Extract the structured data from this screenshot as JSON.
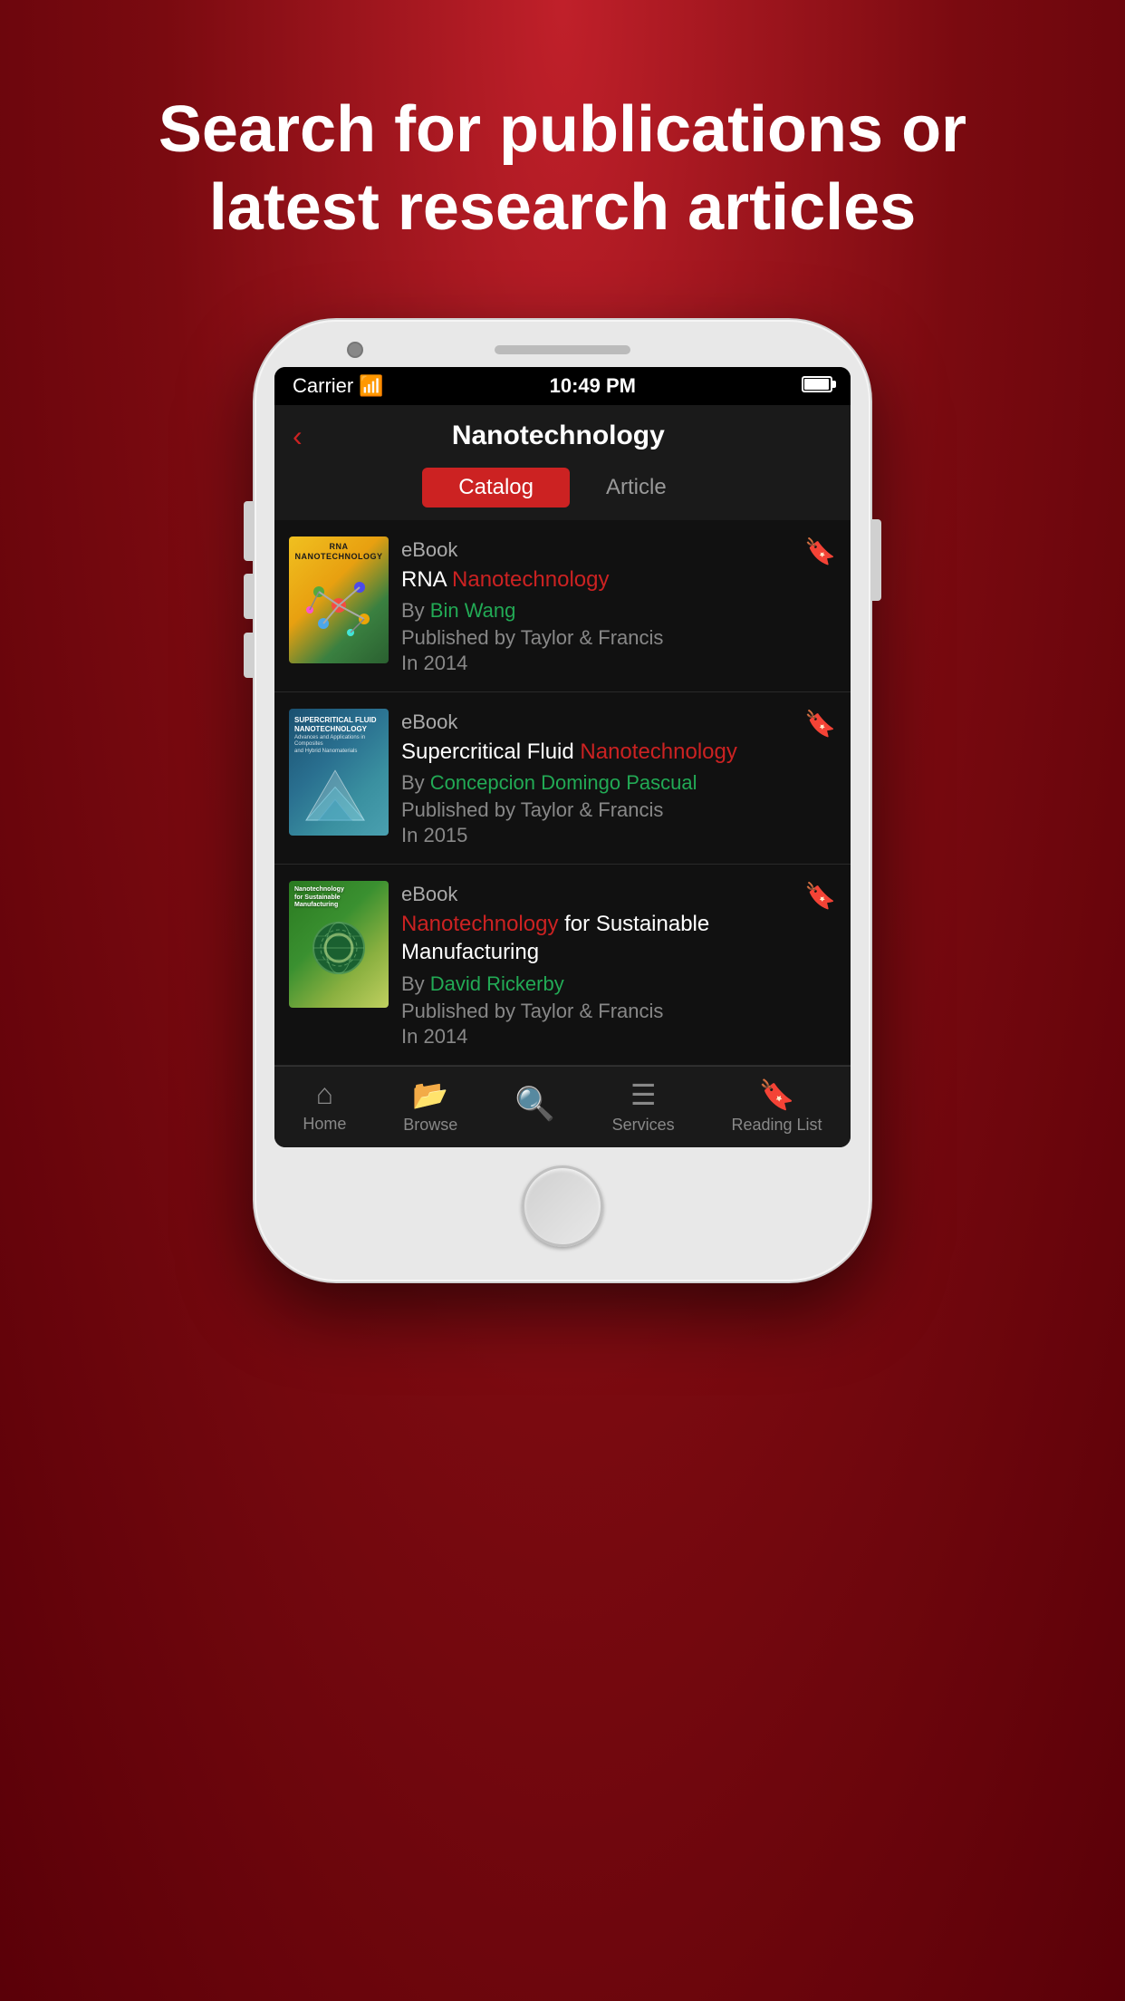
{
  "headline": {
    "text": "Search for publications or latest research articles"
  },
  "status_bar": {
    "carrier": "Carrier",
    "time": "10:49 PM",
    "wifi": "wifi"
  },
  "nav": {
    "back_label": "‹",
    "title": "Nanotechnology"
  },
  "tabs": [
    {
      "label": "Catalog",
      "active": true
    },
    {
      "label": "Article",
      "active": false
    }
  ],
  "books": [
    {
      "type": "eBook",
      "title_plain": "RNA ",
      "title_highlight": "Nanotechnology",
      "author_prefix": "By ",
      "author": "Bin Wang",
      "publisher": "Published by Taylor & Francis",
      "year": "In 2014"
    },
    {
      "type": "eBook",
      "title_plain": "Supercritical Fluid ",
      "title_highlight": "Nanotechnology",
      "author_prefix": "By ",
      "author": "Concepcion Domingo Pascual",
      "publisher": "Published by Taylor & Francis",
      "year": "In 2015"
    },
    {
      "type": "eBook",
      "title_highlight": "Nanotechnology",
      "title_plain": " for Sustainable Manufacturing",
      "author_prefix": "By ",
      "author": "David Rickerby",
      "publisher": "Published by Taylor & Francis",
      "year": "In 2014"
    }
  ],
  "bottom_nav": [
    {
      "label": "Home",
      "icon": "home"
    },
    {
      "label": "Browse",
      "icon": "browse"
    },
    {
      "label": "",
      "icon": "search"
    },
    {
      "label": "Services",
      "icon": "services"
    },
    {
      "label": "Reading List",
      "icon": "reading"
    }
  ]
}
